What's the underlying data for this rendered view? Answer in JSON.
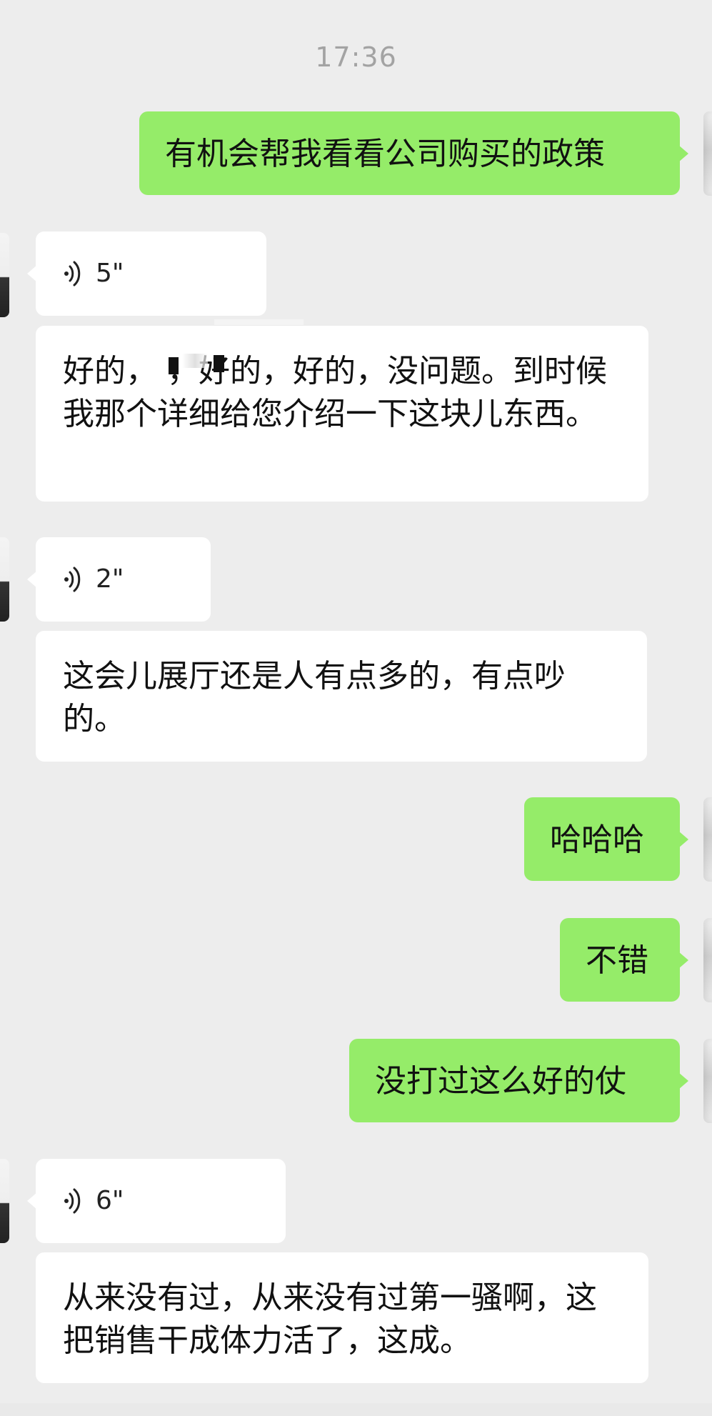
{
  "chat": {
    "timestamp": "17:36",
    "messages": [
      {
        "side": "right",
        "type": "text",
        "text": "有机会帮我看看公司购买的政策"
      },
      {
        "side": "left",
        "type": "voice",
        "duration": "5\""
      },
      {
        "side": "left",
        "type": "text",
        "text": "好的，  ，好的，好的，没问题。到时候我那个详细给您介绍一下这块儿东西。"
      },
      {
        "side": "left",
        "type": "voice",
        "duration": "2\""
      },
      {
        "side": "left",
        "type": "text",
        "text": "这会儿展厅还是人有点多的，有点吵的。"
      },
      {
        "side": "right",
        "type": "text",
        "text": "哈哈哈"
      },
      {
        "side": "right",
        "type": "text",
        "text": "不错"
      },
      {
        "side": "right",
        "type": "text",
        "text": "没打过这么好的仗"
      },
      {
        "side": "left",
        "type": "voice",
        "duration": "6\""
      },
      {
        "side": "left",
        "type": "text",
        "text": "从来没有过，从来没有过第一骚啊，这把销售干成体力活了，这成。"
      }
    ]
  },
  "colors": {
    "background": "#ededed",
    "outgoing_bubble": "#95ec69",
    "incoming_bubble": "#ffffff",
    "timestamp_text": "#a3a3a3"
  },
  "icons": {
    "voice": "voice-wave-icon",
    "avatar": "avatar"
  }
}
